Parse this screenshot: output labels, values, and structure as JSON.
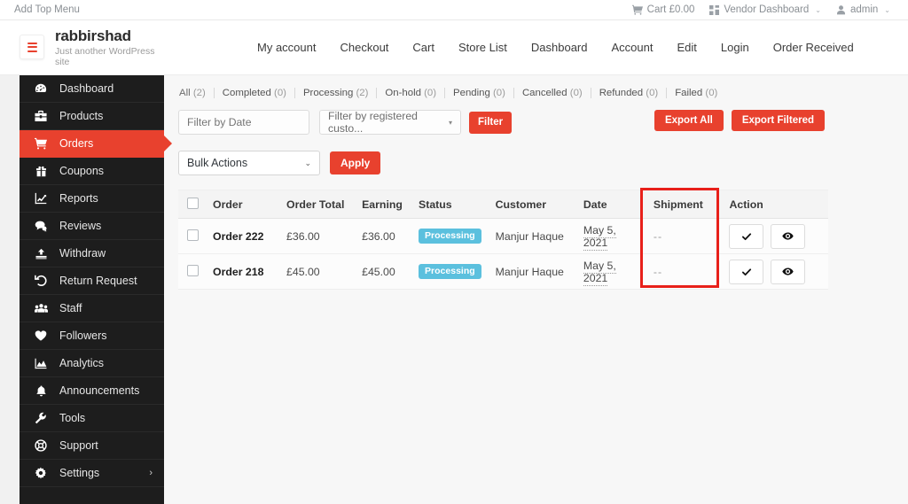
{
  "topbar": {
    "add_top_menu": "Add Top Menu",
    "cart": "Cart £0.00",
    "vendor_dashboard": "Vendor Dashboard",
    "admin": "admin",
    "caret": "⌄",
    "icons": {
      "cart": "cart-icon",
      "grid": "grid-icon",
      "user": "user-icon"
    }
  },
  "header": {
    "site_title": "rabbirshad",
    "tagline": "Just another WordPress site",
    "nav": [
      "My account",
      "Checkout",
      "Cart",
      "Store List",
      "Dashboard",
      "Account",
      "Edit",
      "Login",
      "Order Received"
    ]
  },
  "sidebar": {
    "items": [
      {
        "label": "Dashboard",
        "icon": "speedometer-icon",
        "active": false
      },
      {
        "label": "Products",
        "icon": "briefcase-icon",
        "active": false
      },
      {
        "label": "Orders",
        "icon": "shopping-cart-icon",
        "active": true
      },
      {
        "label": "Coupons",
        "icon": "gift-icon",
        "active": false
      },
      {
        "label": "Reports",
        "icon": "chart-line-icon",
        "active": false
      },
      {
        "label": "Reviews",
        "icon": "comment-icon",
        "active": false
      },
      {
        "label": "Withdraw",
        "icon": "upload-icon",
        "active": false
      },
      {
        "label": "Return Request",
        "icon": "undo-arrow-icon",
        "active": false
      },
      {
        "label": "Staff",
        "icon": "users-icon",
        "active": false
      },
      {
        "label": "Followers",
        "icon": "heart-icon",
        "active": false
      },
      {
        "label": "Analytics",
        "icon": "area-chart-icon",
        "active": false
      },
      {
        "label": "Announcements",
        "icon": "bell-icon",
        "active": false
      },
      {
        "label": "Tools",
        "icon": "wrench-icon",
        "active": false
      },
      {
        "label": "Support",
        "icon": "lifebuoy-icon",
        "active": false
      },
      {
        "label": "Settings",
        "icon": "gear-icon",
        "active": false,
        "chevron": "›"
      }
    ]
  },
  "status_links": [
    {
      "label": "All",
      "count": "(2)",
      "current": true
    },
    {
      "label": "Completed",
      "count": "(0)",
      "current": false
    },
    {
      "label": "Processing",
      "count": "(2)",
      "current": false
    },
    {
      "label": "On-hold",
      "count": "(0)",
      "current": false
    },
    {
      "label": "Pending",
      "count": "(0)",
      "current": false
    },
    {
      "label": "Cancelled",
      "count": "(0)",
      "current": false
    },
    {
      "label": "Refunded",
      "count": "(0)",
      "current": false
    },
    {
      "label": "Failed",
      "count": "(0)",
      "current": false
    }
  ],
  "filters": {
    "date_placeholder": "Filter by Date",
    "date_value": "",
    "customer_value": "Filter by registered custo...",
    "customer_dropdown_caret": "▾",
    "filter_button": "Filter",
    "export_all": "Export All",
    "export_filtered": "Export Filtered"
  },
  "bulk": {
    "selected": "Bulk Actions",
    "caret": "⌄",
    "apply_button": "Apply"
  },
  "table": {
    "columns": [
      "Order",
      "Order Total",
      "Earning",
      "Status",
      "Customer",
      "Date",
      "Shipment",
      "Action"
    ],
    "rows": [
      {
        "order": "Order 222",
        "order_total": "£36.00",
        "earning": "£36.00",
        "status": "Processing",
        "customer": "Manjur Haque",
        "date": "May 5, 2021",
        "shipment": "--",
        "actions": [
          "check-icon",
          "eye-icon"
        ]
      },
      {
        "order": "Order 218",
        "order_total": "£45.00",
        "earning": "£45.00",
        "status": "Processing",
        "customer": "Manjur Haque",
        "date": "May 5, 2021",
        "shipment": "--",
        "actions": [
          "check-icon",
          "eye-icon"
        ]
      }
    ]
  },
  "colors": {
    "brand_red": "#e8412e",
    "annotation_red": "#e8201a",
    "status_processing": "#5bc0de",
    "sidebar_bg": "#1d1d1d"
  }
}
